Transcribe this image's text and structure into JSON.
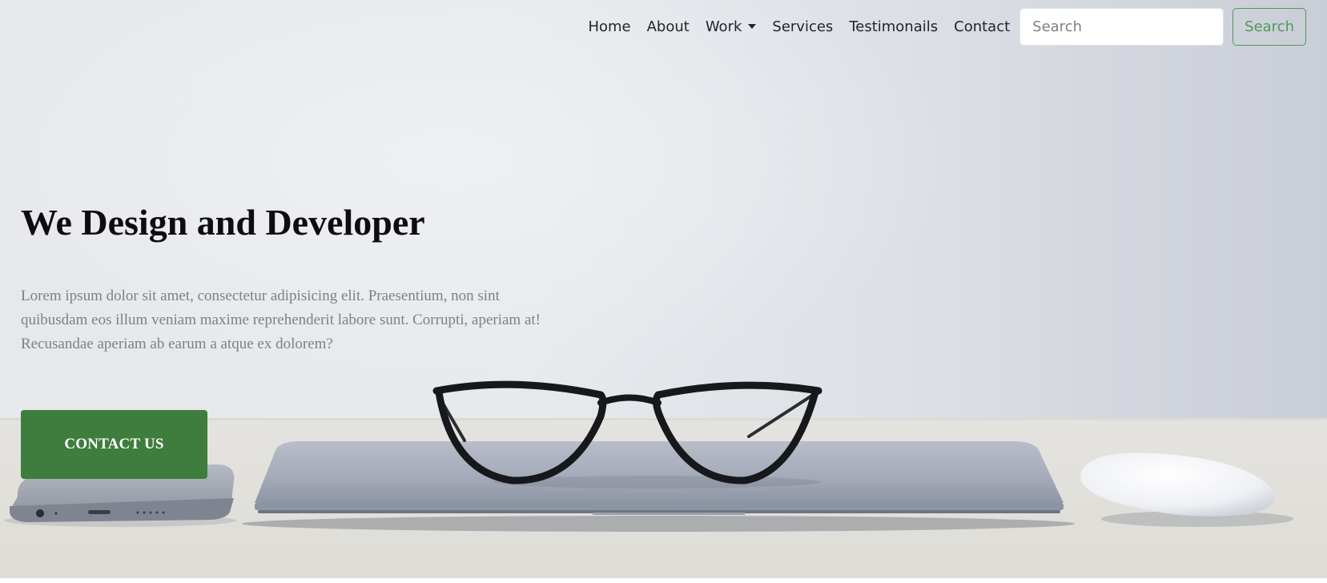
{
  "nav": {
    "items": [
      {
        "label": "Home"
      },
      {
        "label": "About"
      },
      {
        "label": "Work"
      },
      {
        "label": "Services"
      },
      {
        "label": "Testimonails"
      },
      {
        "label": "Contact"
      }
    ],
    "search": {
      "placeholder": "Search",
      "value": "",
      "button_label": "Search"
    }
  },
  "hero": {
    "title": "We Design and Developer",
    "description": "Lorem ipsum dolor sit amet, consectetur adipisicing elit. Praesentium, non sint quibusdam eos illum veniam maxime reprehenderit labore sunt. Corrupti, aperiam at! Recusandae aperiam ab earum a atque ex dolorem?",
    "cta_label": "CONTACT US"
  },
  "colors": {
    "accent_green": "#3e7d3d",
    "search_button_green": "#4f9a57",
    "text_dark": "#212529",
    "text_muted": "#7d8185"
  },
  "icons": {
    "work_dropdown": "chevron-down-icon"
  }
}
